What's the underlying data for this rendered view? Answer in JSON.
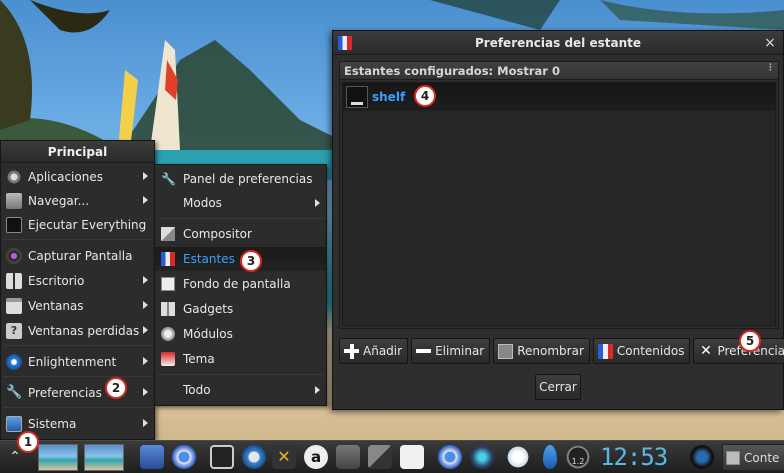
{
  "principal_menu": {
    "title": "Principal",
    "items": [
      {
        "label": "Aplicaciones",
        "icon": "gear-icon",
        "submenu": true
      },
      {
        "label": "Navegar...",
        "icon": "folder-icon",
        "submenu": true
      },
      {
        "label": "Ejecutar Everything",
        "icon": "terminal-icon",
        "submenu": false
      },
      {
        "label": "Capturar Pantalla",
        "icon": "camera-icon",
        "submenu": false
      },
      {
        "label": "Escritorio",
        "icon": "desktop-grid-icon",
        "submenu": true
      },
      {
        "label": "Ventanas",
        "icon": "window-icon",
        "submenu": true
      },
      {
        "label": "Ventanas perdidas",
        "icon": "question-icon",
        "submenu": true
      },
      {
        "label": "Enlightenment",
        "icon": "enlightenment-icon",
        "submenu": true
      },
      {
        "label": "Preferencias",
        "icon": "wrench-icon",
        "submenu": true
      },
      {
        "label": "Sistema",
        "icon": "monitor-icon",
        "submenu": true
      }
    ]
  },
  "preferences_submenu": {
    "items": [
      {
        "label": "Panel de preferencias",
        "icon": "wrench-icon",
        "submenu": false,
        "active": false
      },
      {
        "label": "Modos",
        "icon": "",
        "submenu": true,
        "active": false
      },
      {
        "label": "Compositor",
        "icon": "compositor-icon",
        "submenu": false,
        "active": false
      },
      {
        "label": "Estantes",
        "icon": "shelf-icon",
        "submenu": false,
        "active": true
      },
      {
        "label": "Fondo de pantalla",
        "icon": "wallpaper-icon",
        "submenu": false,
        "active": false
      },
      {
        "label": "Gadgets",
        "icon": "gadgets-icon",
        "submenu": false,
        "active": false
      },
      {
        "label": "Módulos",
        "icon": "modules-icon",
        "submenu": false,
        "active": false
      },
      {
        "label": "Tema",
        "icon": "theme-icon",
        "submenu": false,
        "active": false
      },
      {
        "label": "Todo",
        "icon": "",
        "submenu": true,
        "active": false
      }
    ]
  },
  "dialog": {
    "title": "Preferencias del estante",
    "section_title": "Estantes configurados: Mostrar 0",
    "shelves": [
      {
        "label": "shelf"
      }
    ],
    "buttons": [
      {
        "label": "Añadir",
        "icon": "plus-icon"
      },
      {
        "label": "Eliminar",
        "icon": "minus-icon"
      },
      {
        "label": "Renombrar",
        "icon": "rename-icon"
      },
      {
        "label": "Contenidos",
        "icon": "shelf-icon"
      },
      {
        "label": "Preferencias",
        "icon": "tools-icon"
      }
    ],
    "close_label": "Cerrar"
  },
  "taskbar": {
    "clock": "12:53",
    "gauge_label": "1.2",
    "task_label": "Conte"
  },
  "callouts": [
    "1",
    "2",
    "3",
    "4",
    "5"
  ],
  "colors": {
    "accent_blue": "#3aa0ff",
    "menu_bg": "#2c2c2c",
    "callout_red": "#d82a20"
  }
}
